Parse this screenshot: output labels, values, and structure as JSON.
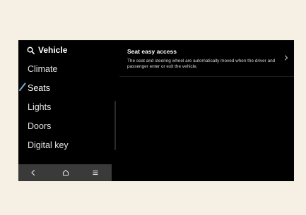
{
  "sidebar": {
    "header": "Vehicle",
    "items": [
      {
        "label": "Climate"
      },
      {
        "label": "Seats"
      },
      {
        "label": "Lights"
      },
      {
        "label": "Doors"
      },
      {
        "label": "Digital key"
      }
    ],
    "active": "Seats"
  },
  "detail": {
    "title": "Seat easy access",
    "description": "The seat and steering wheel are automatically moved when the driver and passenger enter or exit the vehicle."
  },
  "navbar": {
    "buttons": [
      "back-icon",
      "home-icon",
      "menu-icon"
    ]
  },
  "colors": {
    "background": "#f6efe3",
    "screen": "#000000",
    "navbar": "#3a3a3a",
    "accent": "#7aa8d8"
  }
}
